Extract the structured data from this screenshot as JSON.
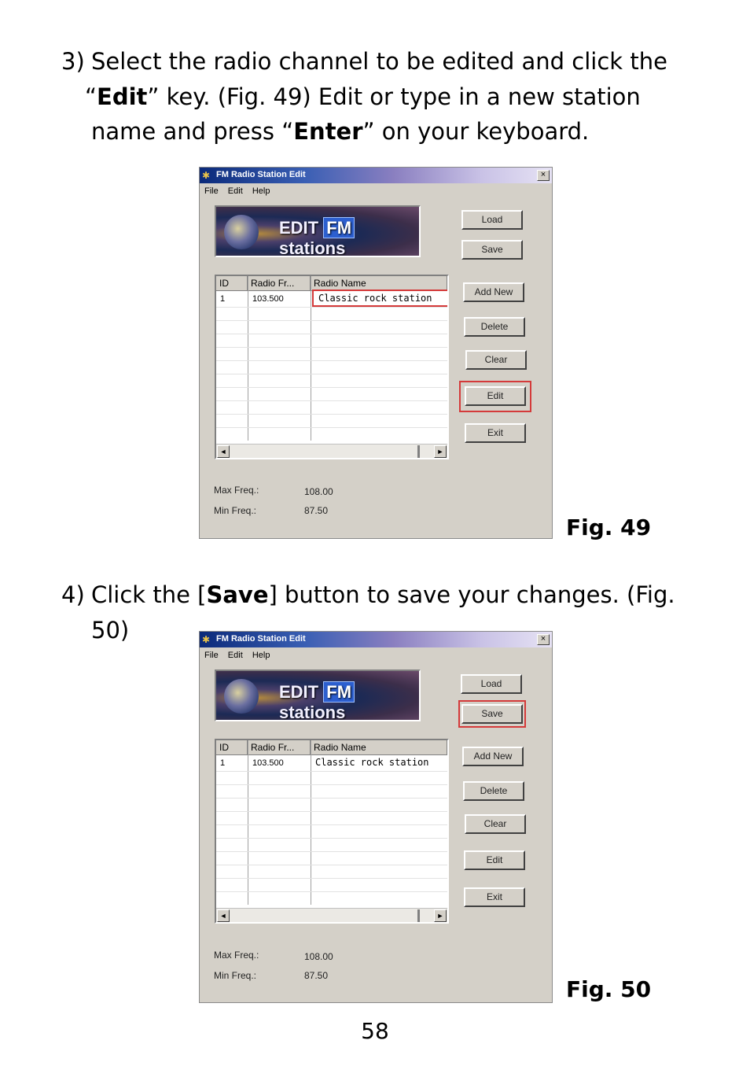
{
  "step3": {
    "number": "3)",
    "line1": "Select the radio channel to be edited and click the",
    "open_quote": "“",
    "edit_key": "Edit",
    "close_quote_key": "” key. (Fig. 49)  Edit or type in a new station",
    "line3_start": "name and press “",
    "enter_key": "Enter",
    "line3_end": "” on your keyboard."
  },
  "step4": {
    "number": "4)",
    "text_start": "Click the [",
    "save_key": "Save",
    "text_end": "] button to save your changes. (Fig. 50)"
  },
  "captions": {
    "fig49": "Fig. 49",
    "fig50": "Fig. 50"
  },
  "page_number": "58",
  "window": {
    "title": "FM Radio Station Edit",
    "close_glyph": "×",
    "menu": [
      "File",
      "Edit",
      "Help"
    ],
    "banner": {
      "edit": "EDIT",
      "fm": "FM",
      "stations": "stations"
    },
    "columns": [
      "ID",
      "Radio Fr...",
      "Radio Name"
    ],
    "row": {
      "id": "1",
      "freq": "103.500",
      "name": "Classic rock station"
    },
    "buttons": [
      "Load",
      "Save",
      "Add New",
      "Delete",
      "Clear",
      "Edit",
      "Exit"
    ],
    "scroll_left": "◄",
    "scroll_right": "►",
    "max_label": "Max Freq.:",
    "max_value": "108.00",
    "min_label": "Min Freq.:",
    "min_value": "87.50"
  },
  "highlight_color": "#d43a3a"
}
